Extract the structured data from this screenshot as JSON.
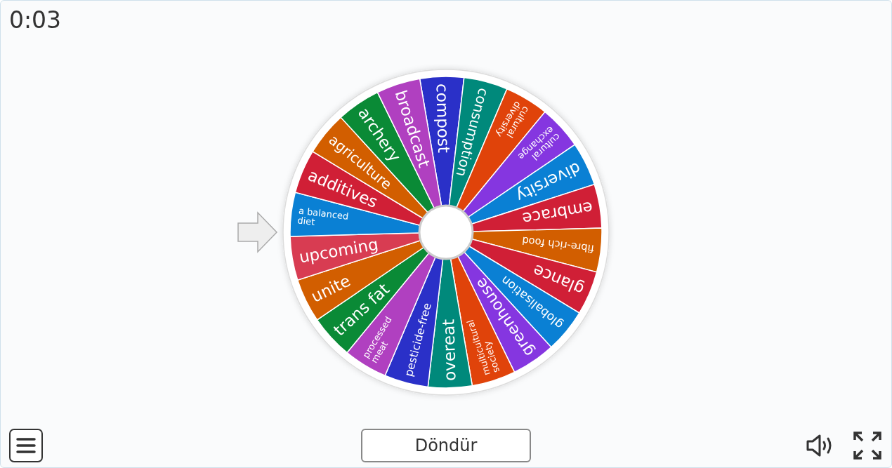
{
  "timer": "0:03",
  "wheel": {
    "segments": [
      {
        "lines": [
          "compost"
        ],
        "color": "#2a30c8"
      },
      {
        "lines": [
          "consumption"
        ],
        "color": "#00897b"
      },
      {
        "lines": [
          "cultural",
          "diversity"
        ],
        "color": "#e0430a"
      },
      {
        "lines": [
          "cultural",
          "exchange"
        ],
        "color": "#8536e0"
      },
      {
        "lines": [
          "diversity"
        ],
        "color": "#0a80d4"
      },
      {
        "lines": [
          "embrace"
        ],
        "color": "#d01f36"
      },
      {
        "lines": [
          "fibre-rich food"
        ],
        "color": "#d25e00"
      },
      {
        "lines": [
          "glance"
        ],
        "color": "#d01f36"
      },
      {
        "lines": [
          "globalisation"
        ],
        "color": "#0a80d4"
      },
      {
        "lines": [
          "greenhouse"
        ],
        "color": "#8536e0"
      },
      {
        "lines": [
          "multicultural",
          "society"
        ],
        "color": "#e0430a"
      },
      {
        "lines": [
          "overeat"
        ],
        "color": "#00897b"
      },
      {
        "lines": [
          "pesticide-free"
        ],
        "color": "#2a30c8"
      },
      {
        "lines": [
          "processed",
          "meat"
        ],
        "color": "#b040c0"
      },
      {
        "lines": [
          "trans fat"
        ],
        "color": "#0a8a36"
      },
      {
        "lines": [
          "unite"
        ],
        "color": "#d25e00"
      },
      {
        "lines": [
          "upcoming"
        ],
        "color": "#d83c52"
      },
      {
        "lines": [
          "a balanced",
          "diet"
        ],
        "color": "#0a80d4"
      },
      {
        "lines": [
          "additives"
        ],
        "color": "#d01f36"
      },
      {
        "lines": [
          "agriculture"
        ],
        "color": "#d25e00"
      },
      {
        "lines": [
          "archery"
        ],
        "color": "#0a8a36"
      },
      {
        "lines": [
          "broadcast"
        ],
        "color": "#b040c0"
      }
    ]
  },
  "spin_button": "Döndür"
}
